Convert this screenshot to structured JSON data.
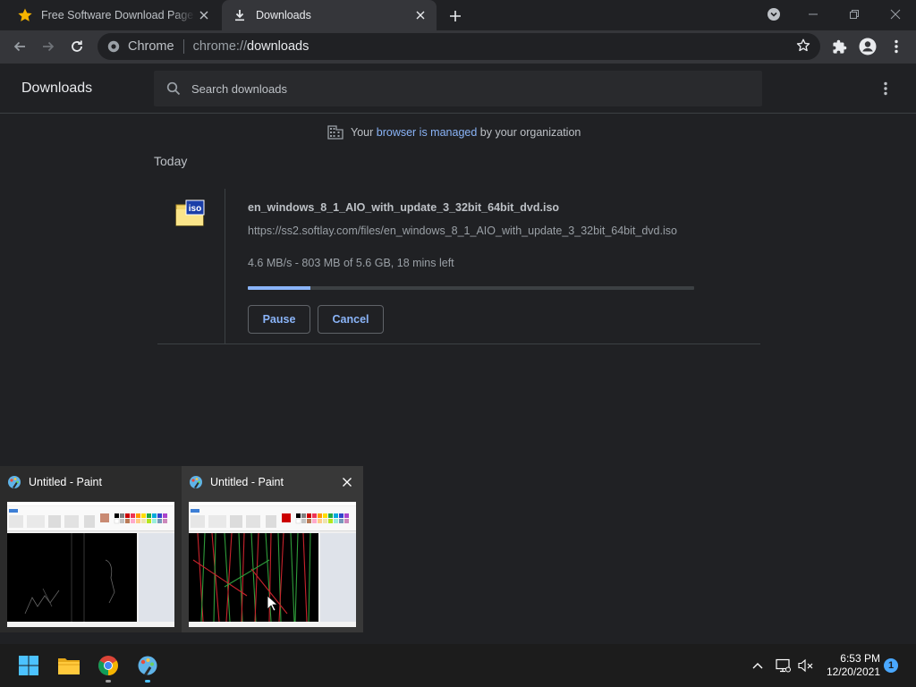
{
  "tabs": [
    {
      "title": "Free Software Download Page - S",
      "favicon": "star-icon",
      "active": false
    },
    {
      "title": "Downloads",
      "favicon": "download-icon",
      "active": true
    }
  ],
  "omnibox": {
    "chip": "Chrome",
    "url_scheme": "chrome://",
    "url_host": "downloads"
  },
  "downloads": {
    "page_title": "Downloads",
    "search_placeholder": "Search downloads",
    "managed_prefix": "Your ",
    "managed_link": "browser is managed",
    "managed_suffix": " by your organization",
    "section_date": "Today",
    "items": [
      {
        "file_name": "en_windows_8_1_AIO_with_update_3_32bit_64bit_dvd.iso",
        "url": "https://ss2.softlay.com/files/en_windows_8_1_AIO_with_update_3_32bit_64bit_dvd.iso",
        "file_type_label": "iso",
        "status": "4.6 MB/s - 803 MB of 5.6 GB, 18 mins left",
        "progress_percent": 14,
        "pause_label": "Pause",
        "cancel_label": "Cancel"
      }
    ]
  },
  "taskbar_preview": {
    "windows": [
      {
        "title": "Untitled - Paint"
      },
      {
        "title": "Untitled - Paint"
      }
    ]
  },
  "taskbar": {
    "apps": [
      "windows-start-icon",
      "file-explorer-icon",
      "chrome-icon",
      "paint-icon"
    ],
    "time": "6:53 PM",
    "date": "12/20/2021",
    "notification_count": "1"
  },
  "colors": {
    "accent": "#8ab4f8",
    "background": "#202124",
    "toolbar": "#35363a"
  }
}
